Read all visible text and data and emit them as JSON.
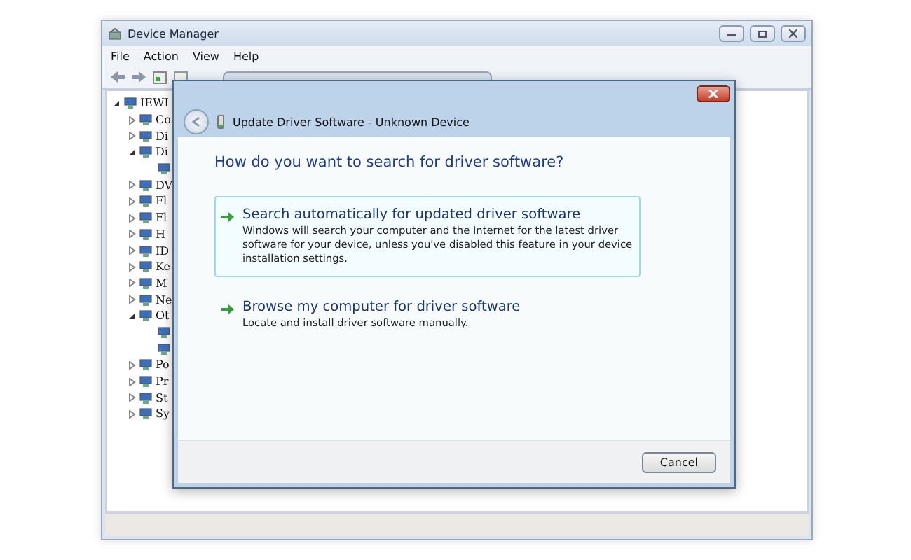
{
  "window": {
    "title": "Device Manager"
  },
  "menu": [
    "File",
    "Action",
    "View",
    "Help"
  ],
  "tree": {
    "label": "IEWI",
    "expanded": true,
    "children": [
      {
        "label": "Co",
        "expanded": false
      },
      {
        "label": "Di",
        "expanded": false
      },
      {
        "label": "Di",
        "expanded": true,
        "children": [
          {
            "selected": false
          }
        ]
      },
      {
        "label": "DV",
        "expanded": false
      },
      {
        "label": "Fl",
        "expanded": false
      },
      {
        "label": "Fl",
        "expanded": false
      },
      {
        "label": "H",
        "expanded": false
      },
      {
        "label": "ID",
        "expanded": false
      },
      {
        "label": "Ke",
        "expanded": false
      },
      {
        "label": "M",
        "expanded": false
      },
      {
        "label": "Ne",
        "expanded": false
      },
      {
        "label": "Ot",
        "expanded": true,
        "children": [
          {
            "selected": false
          },
          {
            "selected": false
          }
        ]
      },
      {
        "label": "Po",
        "expanded": false
      },
      {
        "label": "Pr",
        "expanded": false
      },
      {
        "label": "St",
        "expanded": false
      },
      {
        "label": "Sy",
        "expanded": false
      }
    ]
  },
  "dialog": {
    "title": "Update Driver Software - Unknown Device",
    "heading": "How do you want to search for driver software?",
    "options": [
      {
        "title": "Search automatically for updated driver software",
        "description": "Windows will search your computer and the Internet for the latest driver software for your device, unless you've disabled this feature in your device installation settings.",
        "selected": true
      },
      {
        "title": "Browse my computer for driver software",
        "description": "Locate and install driver software manually.",
        "selected": false
      }
    ],
    "buttons": [
      "Cancel"
    ]
  }
}
